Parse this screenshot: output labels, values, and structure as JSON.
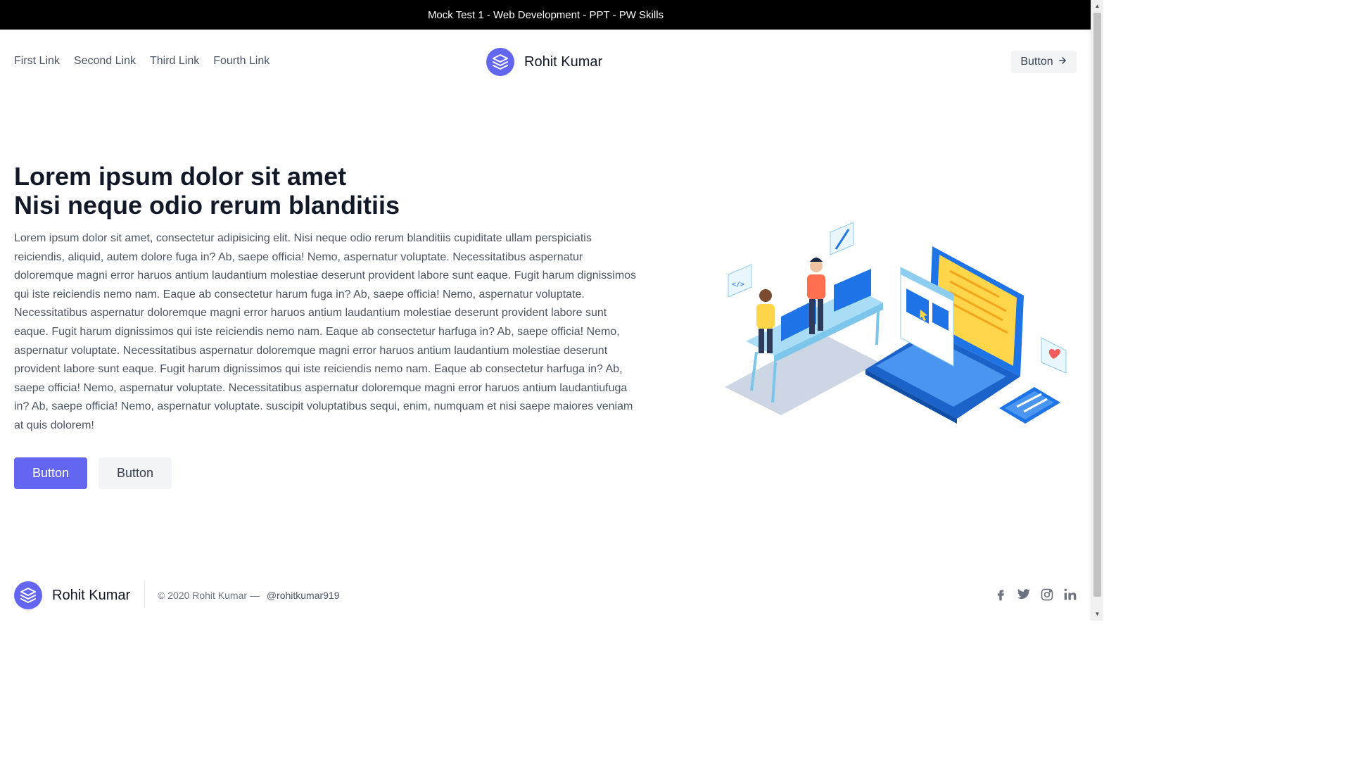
{
  "window": {
    "title": "Mock Test 1 - Web Development - PPT - PW Skills"
  },
  "header": {
    "links": [
      "First Link",
      "Second Link",
      "Third Link",
      "Fourth Link"
    ],
    "brand": "Rohit Kumar",
    "button_label": "Button",
    "button_icon": "arrow-right-icon"
  },
  "hero": {
    "title_line1": "Lorem ipsum dolor sit amet",
    "title_line2": "Nisi neque odio rerum blanditiis",
    "body": "Lorem ipsum dolor sit amet, consectetur adipisicing elit. Nisi neque odio rerum blanditiis cupiditate ullam perspiciatis reiciendis, aliquid, autem dolore fuga in? Ab, saepe officia! Nemo, aspernatur voluptate. Necessitatibus aspernatur doloremque magni error haruos antium laudantium molestiae deserunt provident labore sunt eaque. Fugit harum dignissimos qui iste reiciendis nemo nam. Eaque ab consectetur harum fuga in? Ab, saepe officia! Nemo, aspernatur voluptate. Necessitatibus aspernatur doloremque magni error haruos antium laudantium molestiae deserunt provident labore sunt eaque. Fugit harum dignissimos qui iste reiciendis nemo nam. Eaque ab consectetur harfuga in? Ab, saepe officia! Nemo, aspernatur voluptate. Necessitatibus aspernatur doloremque magni error haruos antium laudantium molestiae deserunt provident labore sunt eaque. Fugit harum dignissimos qui iste reiciendis nemo nam. Eaque ab consectetur harfuga in? Ab, saepe officia! Nemo, aspernatur voluptate. Necessitatibus aspernatur doloremque magni error haruos antium laudantiufuga in? Ab, saepe officia! Nemo, aspernatur voluptate. suscipit voluptatibus sequi, enim, numquam et nisi saepe maiores veniam at quis dolorem!",
    "primary_button": "Button",
    "secondary_button": "Button"
  },
  "footer": {
    "brand": "Rohit Kumar",
    "copyright": "© 2020 Rohit Kumar —",
    "handle": "@rohitkumar919",
    "socials": [
      "facebook-icon",
      "twitter-icon",
      "instagram-icon",
      "linkedin-icon"
    ]
  },
  "colors": {
    "accent": "#6366f1",
    "titlebar": "#000000",
    "button_secondary": "#f3f4f6"
  }
}
